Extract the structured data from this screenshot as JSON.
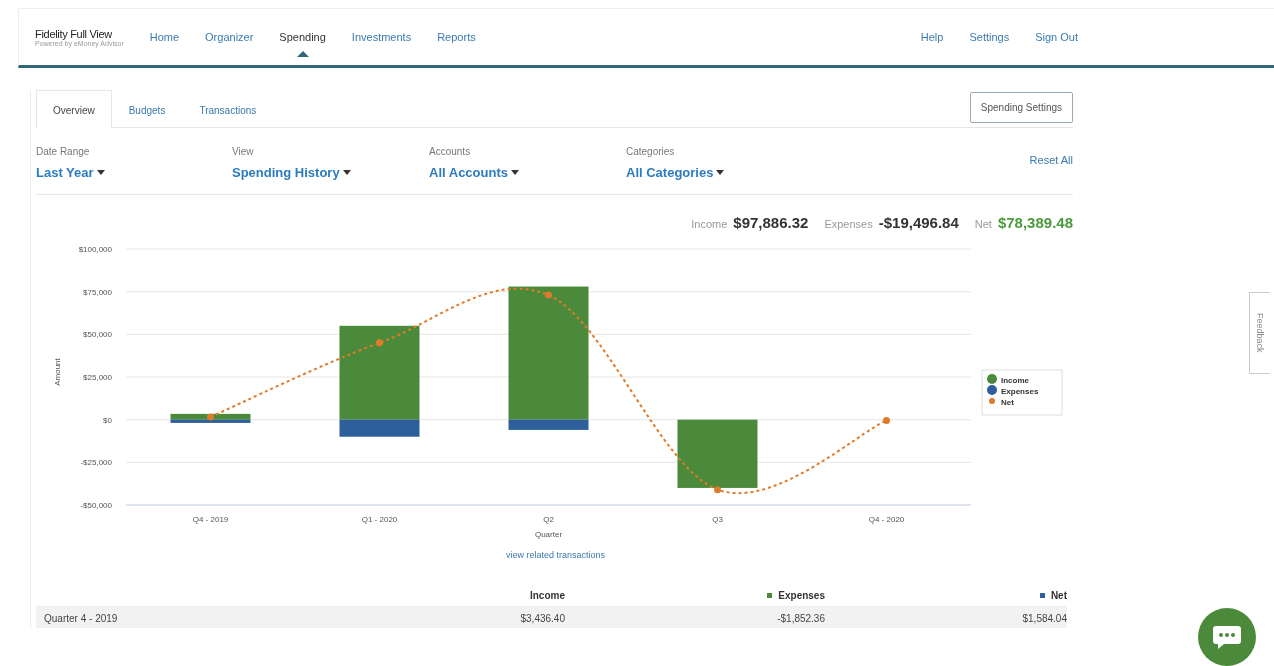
{
  "header": {
    "logo": "Fidelity Full View",
    "logo_tagline": "Powered by eMoney Advisor",
    "nav": [
      {
        "label": "Home",
        "selected": false
      },
      {
        "label": "Organizer",
        "selected": false
      },
      {
        "label": "Spending",
        "selected": true
      },
      {
        "label": "Investments",
        "selected": false
      },
      {
        "label": "Reports",
        "selected": false
      }
    ],
    "links": [
      "Help",
      "Settings",
      "Sign Out"
    ]
  },
  "tabs": [
    {
      "label": "Overview",
      "selected": true
    },
    {
      "label": "Budgets",
      "selected": false
    },
    {
      "label": "Transactions",
      "selected": false
    }
  ],
  "settings_button": "Spending Settings",
  "filters": [
    {
      "label": "Date Range",
      "value": "Last Year"
    },
    {
      "label": "View",
      "value": "Spending History"
    },
    {
      "label": "Accounts",
      "value": "All Accounts"
    },
    {
      "label": "Categories",
      "value": "All Categories"
    }
  ],
  "reset_link": "Reset All",
  "totals": [
    {
      "label": "Income",
      "value": "$97,886.32",
      "color": "#333333"
    },
    {
      "label": "Expenses",
      "value": "-$19,496.84",
      "color": "#333333"
    },
    {
      "label": "Net",
      "value": "$78,389.48",
      "color": "#4c9a3c"
    }
  ],
  "chart_data": {
    "type": "bar",
    "stacked": true,
    "grid": true,
    "legend": true,
    "xlabel": "Quarter",
    "ylabel": "Amount",
    "categories": [
      "Q4 - 2019",
      "Q1 - 2020",
      "Q2",
      "Q3",
      "Q4 - 2020"
    ],
    "ylim": [
      -50000,
      100000
    ],
    "yticks": [
      {
        "value": -50000,
        "label": "-$50,000"
      },
      {
        "value": -25000,
        "label": "-$25,000"
      },
      {
        "value": 0,
        "label": "$0"
      },
      {
        "value": 25000,
        "label": "$25,000"
      },
      {
        "value": 50000,
        "label": "$50,000"
      },
      {
        "value": 75000,
        "label": "$75,000"
      },
      {
        "value": 100000,
        "label": "$100,000"
      }
    ],
    "series": [
      {
        "name": "Income",
        "type": "bar",
        "color": "#4a8a3a",
        "values": [
          3400,
          55000,
          78000,
          -40000,
          0
        ]
      },
      {
        "name": "Expenses",
        "type": "bar",
        "color": "#2d5f9a",
        "values": [
          -1900,
          -10000,
          -6000,
          0,
          0
        ]
      },
      {
        "name": "Net",
        "type": "line",
        "line_style": "dashed",
        "marker": "circle",
        "color": "#e07b2a",
        "values": [
          1600,
          45000,
          73000,
          -41000,
          -500
        ]
      }
    ]
  },
  "related_link": "view related transactions",
  "table": {
    "columns": [
      {
        "label": "Income"
      },
      {
        "label": "Expenses",
        "color": "#4a8a3a"
      },
      {
        "label": "Net",
        "color": "#2d5f9a"
      }
    ],
    "rows": [
      {
        "period": "Quarter 4 - 2019",
        "income": "$3,436.40",
        "expenses": "-$1,852.36",
        "net": "$1,584.04"
      }
    ]
  },
  "feedback_tab": "Feedback"
}
